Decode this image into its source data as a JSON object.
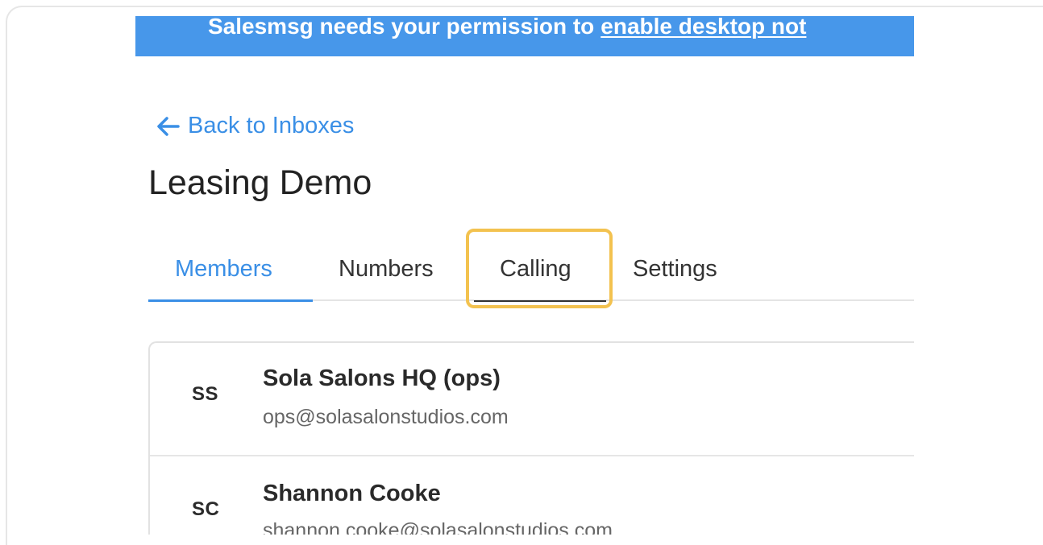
{
  "notification_banner": {
    "text": "Salesmsg needs your permission to",
    "link_text": "enable desktop not"
  },
  "navigation": {
    "back_label": "Back to Inboxes",
    "back_icon": "arrow-left-icon"
  },
  "page": {
    "title": "Leasing Demo"
  },
  "tabs": [
    {
      "label": "Members",
      "active": true
    },
    {
      "label": "Numbers",
      "active": false
    },
    {
      "label": "Calling",
      "active": false,
      "highlighted": true
    },
    {
      "label": "Settings",
      "active": false
    }
  ],
  "members": [
    {
      "initials": "SS",
      "name": "Sola Salons HQ (ops)",
      "email": "ops@solasalonstudios.com"
    },
    {
      "initials": "SC",
      "name": "Shannon Cooke",
      "email": "shannon.cooke@solasalonstudios.com"
    }
  ],
  "colors": {
    "banner": "#4797ea",
    "accent": "#3a8fe6",
    "highlight": "#f3c24f"
  }
}
